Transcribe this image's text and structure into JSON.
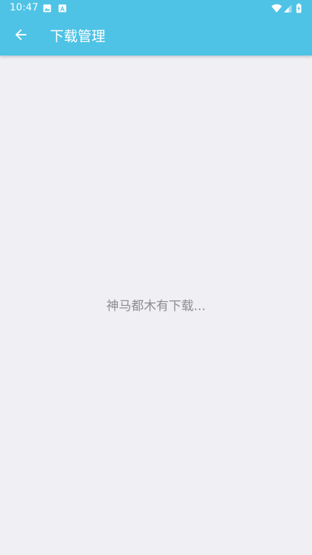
{
  "status_bar": {
    "time": "10:47",
    "left_icons": [
      "image-icon",
      "a-notification-icon"
    ],
    "right_icons": [
      "wifi-icon",
      "cellular-signal-icon",
      "battery-charging-icon"
    ]
  },
  "app_bar": {
    "back_icon": "arrow-back-icon",
    "title": "下载管理",
    "background_color": "#4ec3e6"
  },
  "content": {
    "empty_message": "神马都木有下载...",
    "background_color": "#efeff4"
  }
}
